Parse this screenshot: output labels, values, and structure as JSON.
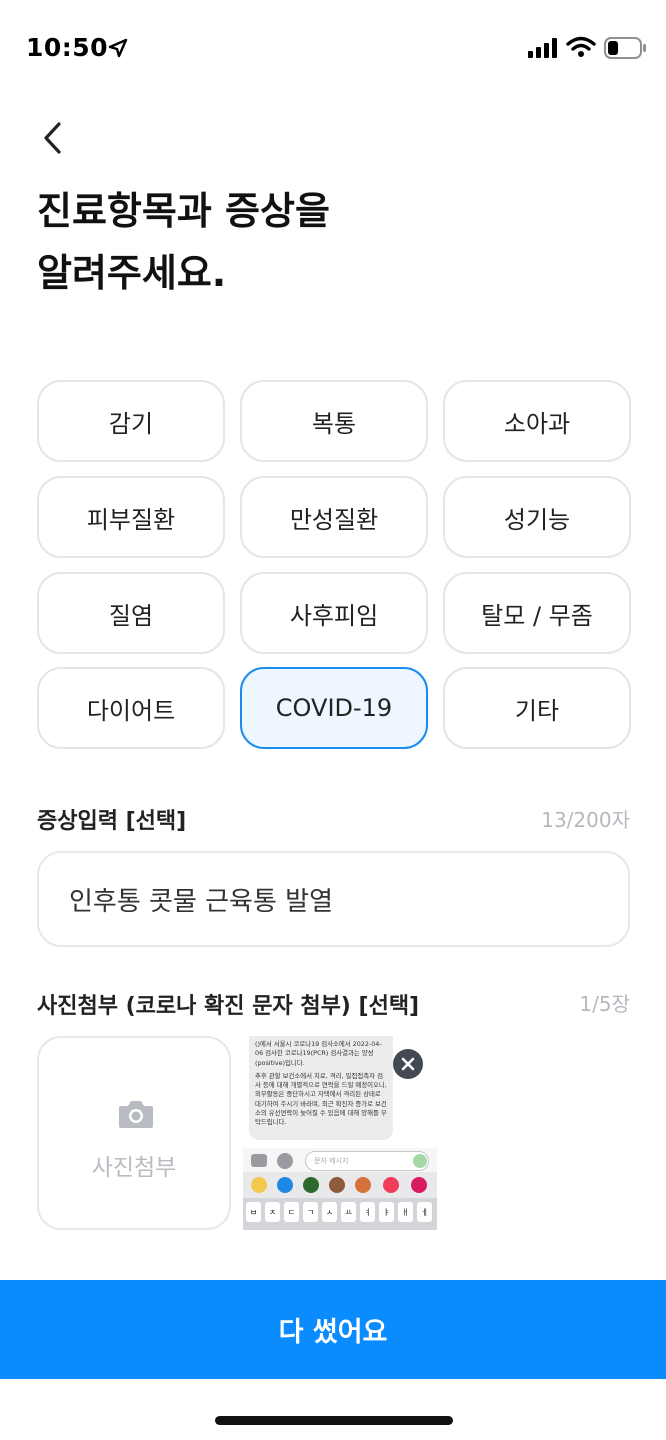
{
  "status_bar": {
    "time": "10:50"
  },
  "header": {
    "title_line1": "진료항목과 증상을",
    "title_line2": "알려주세요."
  },
  "categories": [
    {
      "label": "감기",
      "selected": false
    },
    {
      "label": "복통",
      "selected": false
    },
    {
      "label": "소아과",
      "selected": false
    },
    {
      "label": "피부질환",
      "selected": false
    },
    {
      "label": "만성질환",
      "selected": false
    },
    {
      "label": "성기능",
      "selected": false
    },
    {
      "label": "질염",
      "selected": false
    },
    {
      "label": "사후피임",
      "selected": false
    },
    {
      "label": "탈모 / 무좀",
      "selected": false
    },
    {
      "label": "다이어트",
      "selected": false
    },
    {
      "label": "COVID-19",
      "selected": true
    },
    {
      "label": "기타",
      "selected": false
    }
  ],
  "symptom": {
    "label": "증상입력 [선택]",
    "counter": "13/200자",
    "value": "인후통 콧물 근육통 발열"
  },
  "photo": {
    "label": "사진첨부 (코로나 확진 문자 첨부) [선택]",
    "counter": "1/5장",
    "add_label": "사진첨부",
    "thumbnail_text": {
      "p1": "()에서 서울시 코로나19 검사소에서 2022-04-06 검사한 코로나19(PCR) 검사결과는 양성(positive)입니다.",
      "p2": "추후 관할 보건소에서 치료, 격리, 밀접접촉자 검사 등에 대해 개별적으로 연락을 드릴 예정이오니, 외부활동은 중단하시고 자택에서 격리된 상태로 대기하여 주시기 바라며, 최근 확진자 증가로 보건소의 유선연락이 늦어질 수 있음에 대해 양해를 부탁드립니다.",
      "input_placeholder": "문자 메시지",
      "keys": [
        "ㅂ",
        "ㅈ",
        "ㄷ",
        "ㄱ",
        "ㅅ",
        "ㅛ",
        "ㅕ",
        "ㅑ",
        "ㅐ",
        "ㅔ"
      ]
    }
  },
  "submit": {
    "label": "다 썼어요"
  },
  "colors": {
    "accent": "#0a8cff",
    "selected_border": "#1a8cf0",
    "selected_bg": "#eef7ff"
  }
}
